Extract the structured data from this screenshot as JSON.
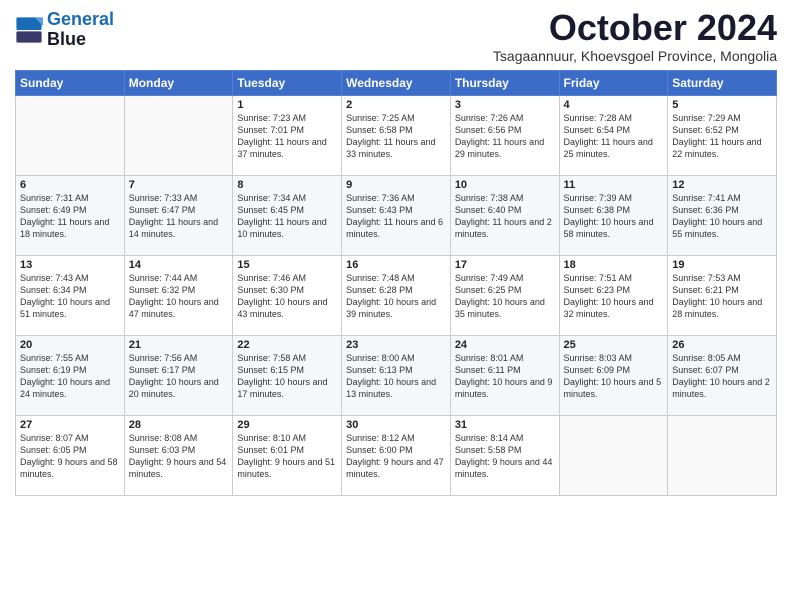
{
  "logo": {
    "line1": "General",
    "line2": "Blue"
  },
  "title": "October 2024",
  "subtitle": "Tsagaannuur, Khoevsgoel Province, Mongolia",
  "weekdays": [
    "Sunday",
    "Monday",
    "Tuesday",
    "Wednesday",
    "Thursday",
    "Friday",
    "Saturday"
  ],
  "weeks": [
    [
      {
        "day": "",
        "sunrise": "",
        "sunset": "",
        "daylight": ""
      },
      {
        "day": "",
        "sunrise": "",
        "sunset": "",
        "daylight": ""
      },
      {
        "day": "1",
        "sunrise": "Sunrise: 7:23 AM",
        "sunset": "Sunset: 7:01 PM",
        "daylight": "Daylight: 11 hours and 37 minutes."
      },
      {
        "day": "2",
        "sunrise": "Sunrise: 7:25 AM",
        "sunset": "Sunset: 6:58 PM",
        "daylight": "Daylight: 11 hours and 33 minutes."
      },
      {
        "day": "3",
        "sunrise": "Sunrise: 7:26 AM",
        "sunset": "Sunset: 6:56 PM",
        "daylight": "Daylight: 11 hours and 29 minutes."
      },
      {
        "day": "4",
        "sunrise": "Sunrise: 7:28 AM",
        "sunset": "Sunset: 6:54 PM",
        "daylight": "Daylight: 11 hours and 25 minutes."
      },
      {
        "day": "5",
        "sunrise": "Sunrise: 7:29 AM",
        "sunset": "Sunset: 6:52 PM",
        "daylight": "Daylight: 11 hours and 22 minutes."
      }
    ],
    [
      {
        "day": "6",
        "sunrise": "Sunrise: 7:31 AM",
        "sunset": "Sunset: 6:49 PM",
        "daylight": "Daylight: 11 hours and 18 minutes."
      },
      {
        "day": "7",
        "sunrise": "Sunrise: 7:33 AM",
        "sunset": "Sunset: 6:47 PM",
        "daylight": "Daylight: 11 hours and 14 minutes."
      },
      {
        "day": "8",
        "sunrise": "Sunrise: 7:34 AM",
        "sunset": "Sunset: 6:45 PM",
        "daylight": "Daylight: 11 hours and 10 minutes."
      },
      {
        "day": "9",
        "sunrise": "Sunrise: 7:36 AM",
        "sunset": "Sunset: 6:43 PM",
        "daylight": "Daylight: 11 hours and 6 minutes."
      },
      {
        "day": "10",
        "sunrise": "Sunrise: 7:38 AM",
        "sunset": "Sunset: 6:40 PM",
        "daylight": "Daylight: 11 hours and 2 minutes."
      },
      {
        "day": "11",
        "sunrise": "Sunrise: 7:39 AM",
        "sunset": "Sunset: 6:38 PM",
        "daylight": "Daylight: 10 hours and 58 minutes."
      },
      {
        "day": "12",
        "sunrise": "Sunrise: 7:41 AM",
        "sunset": "Sunset: 6:36 PM",
        "daylight": "Daylight: 10 hours and 55 minutes."
      }
    ],
    [
      {
        "day": "13",
        "sunrise": "Sunrise: 7:43 AM",
        "sunset": "Sunset: 6:34 PM",
        "daylight": "Daylight: 10 hours and 51 minutes."
      },
      {
        "day": "14",
        "sunrise": "Sunrise: 7:44 AM",
        "sunset": "Sunset: 6:32 PM",
        "daylight": "Daylight: 10 hours and 47 minutes."
      },
      {
        "day": "15",
        "sunrise": "Sunrise: 7:46 AM",
        "sunset": "Sunset: 6:30 PM",
        "daylight": "Daylight: 10 hours and 43 minutes."
      },
      {
        "day": "16",
        "sunrise": "Sunrise: 7:48 AM",
        "sunset": "Sunset: 6:28 PM",
        "daylight": "Daylight: 10 hours and 39 minutes."
      },
      {
        "day": "17",
        "sunrise": "Sunrise: 7:49 AM",
        "sunset": "Sunset: 6:25 PM",
        "daylight": "Daylight: 10 hours and 35 minutes."
      },
      {
        "day": "18",
        "sunrise": "Sunrise: 7:51 AM",
        "sunset": "Sunset: 6:23 PM",
        "daylight": "Daylight: 10 hours and 32 minutes."
      },
      {
        "day": "19",
        "sunrise": "Sunrise: 7:53 AM",
        "sunset": "Sunset: 6:21 PM",
        "daylight": "Daylight: 10 hours and 28 minutes."
      }
    ],
    [
      {
        "day": "20",
        "sunrise": "Sunrise: 7:55 AM",
        "sunset": "Sunset: 6:19 PM",
        "daylight": "Daylight: 10 hours and 24 minutes."
      },
      {
        "day": "21",
        "sunrise": "Sunrise: 7:56 AM",
        "sunset": "Sunset: 6:17 PM",
        "daylight": "Daylight: 10 hours and 20 minutes."
      },
      {
        "day": "22",
        "sunrise": "Sunrise: 7:58 AM",
        "sunset": "Sunset: 6:15 PM",
        "daylight": "Daylight: 10 hours and 17 minutes."
      },
      {
        "day": "23",
        "sunrise": "Sunrise: 8:00 AM",
        "sunset": "Sunset: 6:13 PM",
        "daylight": "Daylight: 10 hours and 13 minutes."
      },
      {
        "day": "24",
        "sunrise": "Sunrise: 8:01 AM",
        "sunset": "Sunset: 6:11 PM",
        "daylight": "Daylight: 10 hours and 9 minutes."
      },
      {
        "day": "25",
        "sunrise": "Sunrise: 8:03 AM",
        "sunset": "Sunset: 6:09 PM",
        "daylight": "Daylight: 10 hours and 5 minutes."
      },
      {
        "day": "26",
        "sunrise": "Sunrise: 8:05 AM",
        "sunset": "Sunset: 6:07 PM",
        "daylight": "Daylight: 10 hours and 2 minutes."
      }
    ],
    [
      {
        "day": "27",
        "sunrise": "Sunrise: 8:07 AM",
        "sunset": "Sunset: 6:05 PM",
        "daylight": "Daylight: 9 hours and 58 minutes."
      },
      {
        "day": "28",
        "sunrise": "Sunrise: 8:08 AM",
        "sunset": "Sunset: 6:03 PM",
        "daylight": "Daylight: 9 hours and 54 minutes."
      },
      {
        "day": "29",
        "sunrise": "Sunrise: 8:10 AM",
        "sunset": "Sunset: 6:01 PM",
        "daylight": "Daylight: 9 hours and 51 minutes."
      },
      {
        "day": "30",
        "sunrise": "Sunrise: 8:12 AM",
        "sunset": "Sunset: 6:00 PM",
        "daylight": "Daylight: 9 hours and 47 minutes."
      },
      {
        "day": "31",
        "sunrise": "Sunrise: 8:14 AM",
        "sunset": "Sunset: 5:58 PM",
        "daylight": "Daylight: 9 hours and 44 minutes."
      },
      {
        "day": "",
        "sunrise": "",
        "sunset": "",
        "daylight": ""
      },
      {
        "day": "",
        "sunrise": "",
        "sunset": "",
        "daylight": ""
      }
    ]
  ]
}
